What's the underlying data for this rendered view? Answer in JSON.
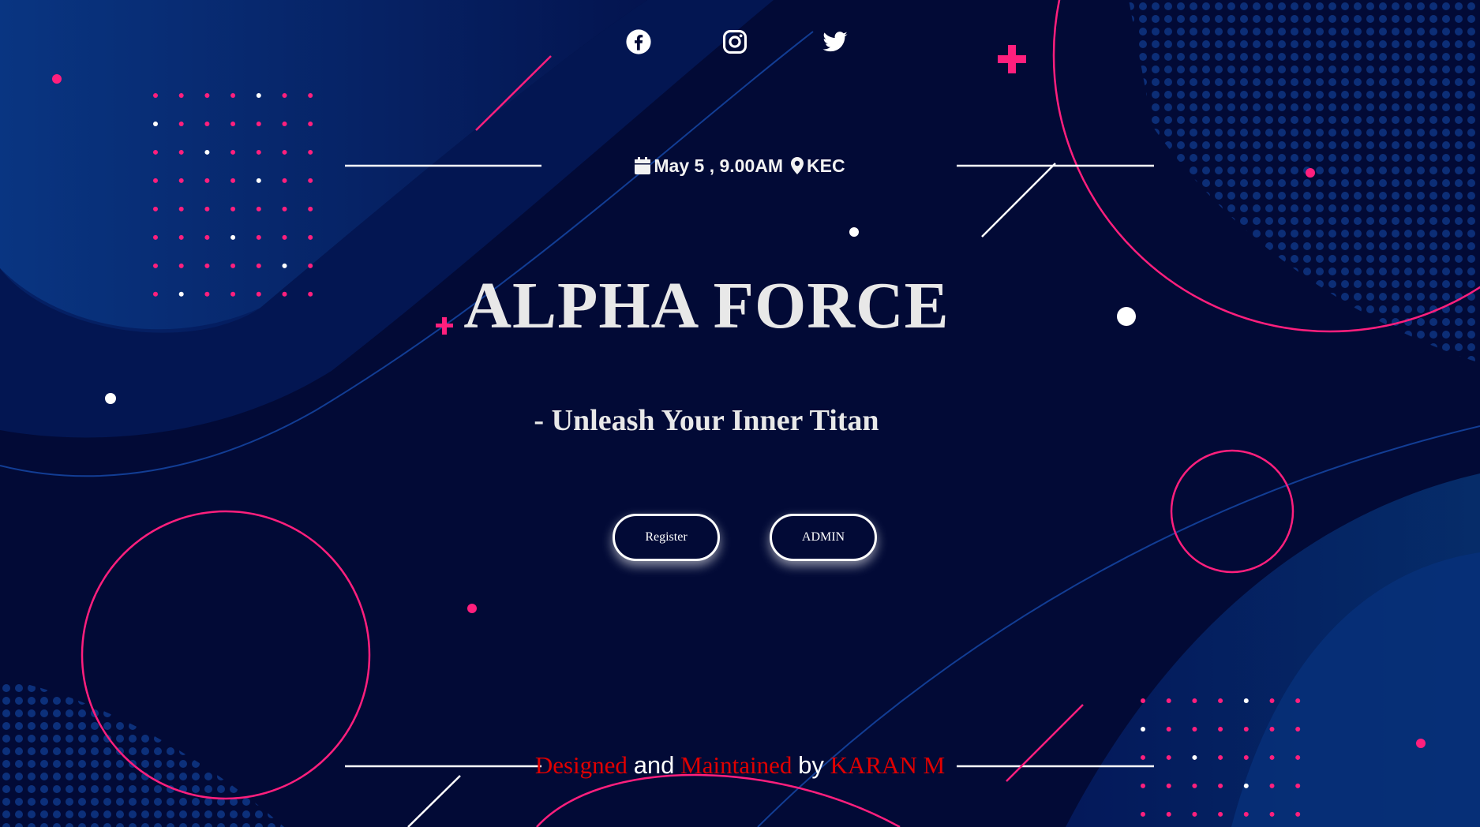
{
  "social": {
    "icons": [
      "facebook-icon",
      "instagram-icon",
      "twitter-icon"
    ]
  },
  "event": {
    "date_time": "May 5 , 9.00AM",
    "location": "KEC"
  },
  "hero": {
    "title": "ALPHA FORCE",
    "tagline": "- Unleash Your Inner Titan"
  },
  "actions": {
    "register_label": "Register",
    "admin_label": "ADMIN"
  },
  "footer": {
    "part1": "Designed",
    "part2": "and",
    "part3": "Maintained",
    "part4": "by",
    "part5": "KARAN M"
  },
  "colors": {
    "background": "#020a36",
    "accent_pink": "#ff1f7d",
    "text_light": "#e8e8e8",
    "footer_red": "#e00000"
  }
}
